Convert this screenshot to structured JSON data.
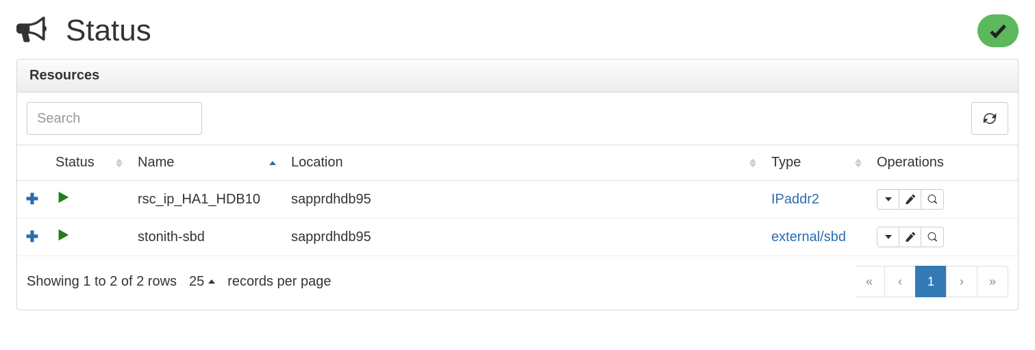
{
  "page": {
    "title": "Status",
    "panel_title": "Resources"
  },
  "toolbar": {
    "search_placeholder": "Search"
  },
  "columns": {
    "status": "Status",
    "name": "Name",
    "location": "Location",
    "type": "Type",
    "operations": "Operations"
  },
  "rows": [
    {
      "name": "rsc_ip_HA1_HDB10",
      "location": "sapprdhdb95",
      "type": "IPaddr2"
    },
    {
      "name": "stonith-sbd",
      "location": "sapprdhdb95",
      "type": "external/sbd"
    }
  ],
  "footer": {
    "showing": "Showing 1 to 2 of 2 rows",
    "page_size": "25",
    "records_label": "records per page"
  },
  "pagination": {
    "first": "«",
    "prev": "‹",
    "current": "1",
    "next": "›",
    "last": "»"
  }
}
